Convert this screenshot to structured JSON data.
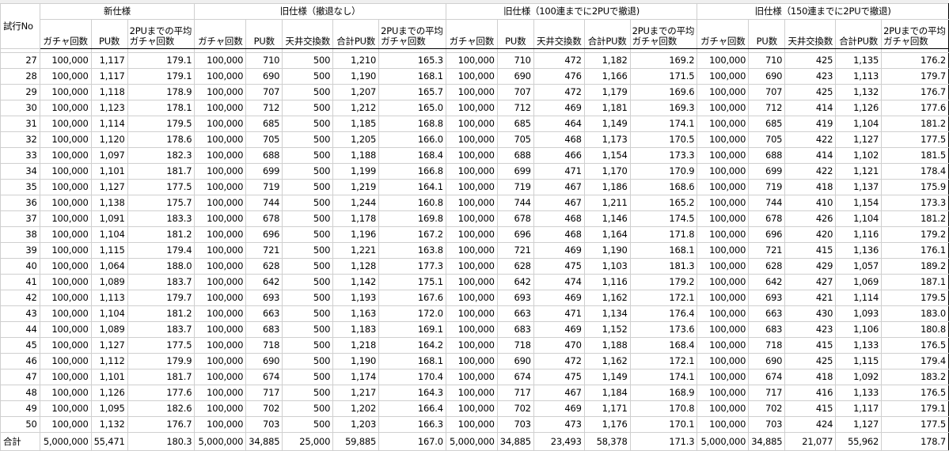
{
  "header_groups": [
    {
      "label": "新仕様",
      "span": 3
    },
    {
      "label": "旧仕様（撤退なし）",
      "span": 5
    },
    {
      "label": "旧仕様（100連までに2PUで撤退)",
      "span": 5
    },
    {
      "label": "旧仕様（150連までに2PUで撤退)",
      "span": 5
    }
  ],
  "row_header": "試行No",
  "column_headers": [
    "ガチャ回数",
    "PU数",
    "2PUまでの平均ガチャ回数",
    "ガチャ回数",
    "PU数",
    "天井交換数",
    "合計PU数",
    "2PUまでの平均ガチャ回数",
    "ガチャ回数",
    "PU数",
    "天井交換数",
    "合計PU数",
    "2PUまでの平均ガチャ回数",
    "ガチャ回数",
    "PU数",
    "天井交換数",
    "合計PU数",
    "2PUまでの平均ガチャ回数"
  ],
  "rows": [
    [
      "27",
      "100,000",
      "1,117",
      "179.1",
      "100,000",
      "710",
      "500",
      "1,210",
      "165.3",
      "100,000",
      "710",
      "472",
      "1,182",
      "169.2",
      "100,000",
      "710",
      "425",
      "1,135",
      "176.2"
    ],
    [
      "28",
      "100,000",
      "1,117",
      "179.1",
      "100,000",
      "690",
      "500",
      "1,190",
      "168.1",
      "100,000",
      "690",
      "476",
      "1,166",
      "171.5",
      "100,000",
      "690",
      "423",
      "1,113",
      "179.7"
    ],
    [
      "29",
      "100,000",
      "1,118",
      "178.9",
      "100,000",
      "707",
      "500",
      "1,207",
      "165.7",
      "100,000",
      "707",
      "472",
      "1,179",
      "169.6",
      "100,000",
      "707",
      "425",
      "1,132",
      "176.7"
    ],
    [
      "30",
      "100,000",
      "1,123",
      "178.1",
      "100,000",
      "712",
      "500",
      "1,212",
      "165.0",
      "100,000",
      "712",
      "469",
      "1,181",
      "169.3",
      "100,000",
      "712",
      "414",
      "1,126",
      "177.6"
    ],
    [
      "31",
      "100,000",
      "1,114",
      "179.5",
      "100,000",
      "685",
      "500",
      "1,185",
      "168.8",
      "100,000",
      "685",
      "464",
      "1,149",
      "174.1",
      "100,000",
      "685",
      "419",
      "1,104",
      "181.2"
    ],
    [
      "32",
      "100,000",
      "1,120",
      "178.6",
      "100,000",
      "705",
      "500",
      "1,205",
      "166.0",
      "100,000",
      "705",
      "468",
      "1,173",
      "170.5",
      "100,000",
      "705",
      "422",
      "1,127",
      "177.5"
    ],
    [
      "33",
      "100,000",
      "1,097",
      "182.3",
      "100,000",
      "688",
      "500",
      "1,188",
      "168.4",
      "100,000",
      "688",
      "466",
      "1,154",
      "173.3",
      "100,000",
      "688",
      "414",
      "1,102",
      "181.5"
    ],
    [
      "34",
      "100,000",
      "1,101",
      "181.7",
      "100,000",
      "699",
      "500",
      "1,199",
      "166.8",
      "100,000",
      "699",
      "471",
      "1,170",
      "170.9",
      "100,000",
      "699",
      "422",
      "1,121",
      "178.4"
    ],
    [
      "35",
      "100,000",
      "1,127",
      "177.5",
      "100,000",
      "719",
      "500",
      "1,219",
      "164.1",
      "100,000",
      "719",
      "467",
      "1,186",
      "168.6",
      "100,000",
      "719",
      "418",
      "1,137",
      "175.9"
    ],
    [
      "36",
      "100,000",
      "1,138",
      "175.7",
      "100,000",
      "744",
      "500",
      "1,244",
      "160.8",
      "100,000",
      "744",
      "467",
      "1,211",
      "165.2",
      "100,000",
      "744",
      "410",
      "1,154",
      "173.3"
    ],
    [
      "37",
      "100,000",
      "1,091",
      "183.3",
      "100,000",
      "678",
      "500",
      "1,178",
      "169.8",
      "100,000",
      "678",
      "468",
      "1,146",
      "174.5",
      "100,000",
      "678",
      "426",
      "1,104",
      "181.2"
    ],
    [
      "38",
      "100,000",
      "1,104",
      "181.2",
      "100,000",
      "696",
      "500",
      "1,196",
      "167.2",
      "100,000",
      "696",
      "468",
      "1,164",
      "171.8",
      "100,000",
      "696",
      "420",
      "1,116",
      "179.2"
    ],
    [
      "39",
      "100,000",
      "1,115",
      "179.4",
      "100,000",
      "721",
      "500",
      "1,221",
      "163.8",
      "100,000",
      "721",
      "469",
      "1,190",
      "168.1",
      "100,000",
      "721",
      "415",
      "1,136",
      "176.1"
    ],
    [
      "40",
      "100,000",
      "1,064",
      "188.0",
      "100,000",
      "628",
      "500",
      "1,128",
      "177.3",
      "100,000",
      "628",
      "475",
      "1,103",
      "181.3",
      "100,000",
      "628",
      "429",
      "1,057",
      "189.2"
    ],
    [
      "41",
      "100,000",
      "1,089",
      "183.7",
      "100,000",
      "642",
      "500",
      "1,142",
      "175.1",
      "100,000",
      "642",
      "474",
      "1,116",
      "179.2",
      "100,000",
      "642",
      "427",
      "1,069",
      "187.1"
    ],
    [
      "42",
      "100,000",
      "1,113",
      "179.7",
      "100,000",
      "693",
      "500",
      "1,193",
      "167.6",
      "100,000",
      "693",
      "469",
      "1,162",
      "172.1",
      "100,000",
      "693",
      "421",
      "1,114",
      "179.5"
    ],
    [
      "43",
      "100,000",
      "1,104",
      "181.2",
      "100,000",
      "663",
      "500",
      "1,163",
      "172.0",
      "100,000",
      "663",
      "471",
      "1,134",
      "176.4",
      "100,000",
      "663",
      "430",
      "1,093",
      "183.0"
    ],
    [
      "44",
      "100,000",
      "1,089",
      "183.7",
      "100,000",
      "683",
      "500",
      "1,183",
      "169.1",
      "100,000",
      "683",
      "469",
      "1,152",
      "173.6",
      "100,000",
      "683",
      "423",
      "1,106",
      "180.8"
    ],
    [
      "45",
      "100,000",
      "1,127",
      "177.5",
      "100,000",
      "718",
      "500",
      "1,218",
      "164.2",
      "100,000",
      "718",
      "470",
      "1,188",
      "168.4",
      "100,000",
      "718",
      "415",
      "1,133",
      "176.5"
    ],
    [
      "46",
      "100,000",
      "1,112",
      "179.9",
      "100,000",
      "690",
      "500",
      "1,190",
      "168.1",
      "100,000",
      "690",
      "472",
      "1,162",
      "172.1",
      "100,000",
      "690",
      "425",
      "1,115",
      "179.4"
    ],
    [
      "47",
      "100,000",
      "1,101",
      "181.7",
      "100,000",
      "674",
      "500",
      "1,174",
      "170.4",
      "100,000",
      "674",
      "475",
      "1,149",
      "174.1",
      "100,000",
      "674",
      "418",
      "1,092",
      "183.2"
    ],
    [
      "48",
      "100,000",
      "1,126",
      "177.6",
      "100,000",
      "717",
      "500",
      "1,217",
      "164.3",
      "100,000",
      "717",
      "467",
      "1,184",
      "168.9",
      "100,000",
      "717",
      "416",
      "1,133",
      "176.5"
    ],
    [
      "49",
      "100,000",
      "1,095",
      "182.6",
      "100,000",
      "702",
      "500",
      "1,202",
      "166.4",
      "100,000",
      "702",
      "469",
      "1,171",
      "170.8",
      "100,000",
      "702",
      "415",
      "1,117",
      "179.1"
    ],
    [
      "50",
      "100,000",
      "1,132",
      "176.7",
      "100,000",
      "703",
      "500",
      "1,203",
      "166.3",
      "100,000",
      "703",
      "473",
      "1,176",
      "170.1",
      "100,000",
      "703",
      "424",
      "1,127",
      "177.5"
    ]
  ],
  "total_row": [
    "合計",
    "5,000,000",
    "55,471",
    "180.3",
    "5,000,000",
    "34,885",
    "25,000",
    "59,885",
    "167.0",
    "5,000,000",
    "34,885",
    "23,493",
    "58,378",
    "171.3",
    "5,000,000",
    "34,885",
    "21,077",
    "55,962",
    "178.7"
  ]
}
